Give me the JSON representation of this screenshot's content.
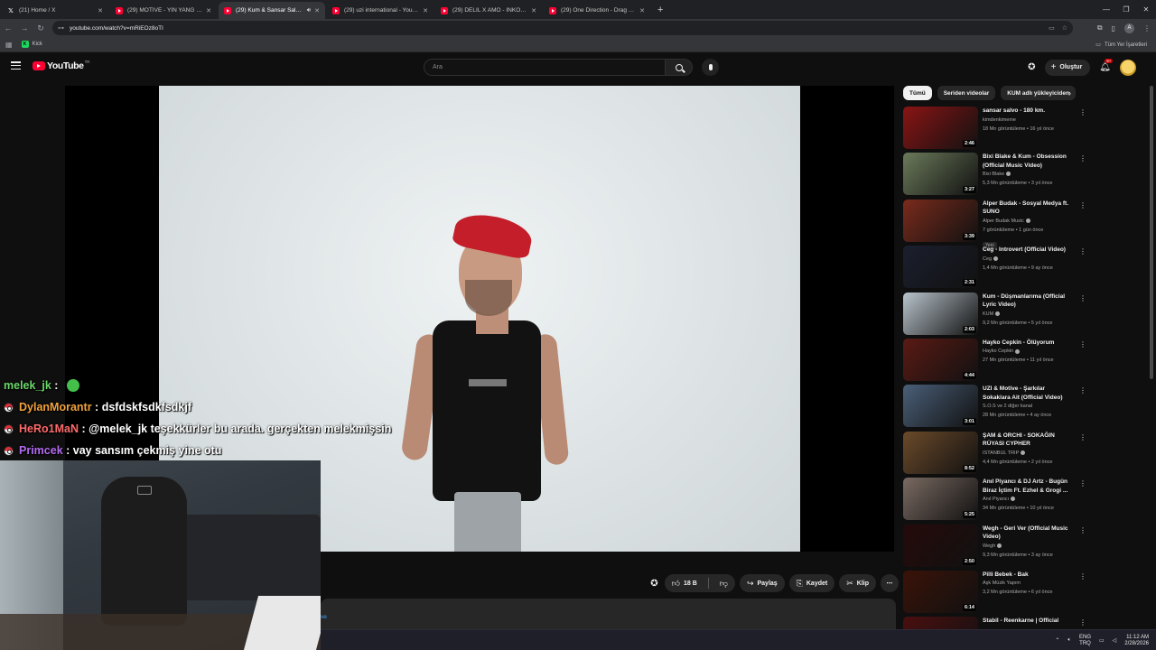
{
  "browser": {
    "tabs": [
      {
        "label": "(21) Home / X",
        "favicon": "x-icon",
        "active": false
      },
      {
        "label": "(29) MOTIVE - YIN YANG (Offici...",
        "favicon": "youtube-icon",
        "active": false
      },
      {
        "label": "(29) Kum & Sansar Salvo - S...",
        "favicon": "youtube-icon",
        "active": true,
        "audio": true
      },
      {
        "label": "(29) uzi international - YouTube",
        "favicon": "youtube-icon",
        "active": false
      },
      {
        "label": "(29) DELIL X AMO - INKOGNITO",
        "favicon": "youtube-icon",
        "active": false
      },
      {
        "label": "(29) One Direction - Drag Me D...",
        "favicon": "youtube-icon",
        "active": false
      }
    ],
    "url": "youtube.com/watch?v=mRiEOz8oTI",
    "bookmarks": [
      {
        "label": "Kick"
      }
    ],
    "all_bookmarks_label": "Tüm Yer İşaretleri"
  },
  "youtube": {
    "logo_text": "YouTube",
    "logo_country": "TR",
    "search_placeholder": "Ara",
    "create_label": "Oluştur",
    "notification_count": "9+"
  },
  "video": {
    "likes": "18 B",
    "share_label": "Paylaş",
    "save_label": "Kaydet",
    "clip_label": "Klip",
    "description_link": "ve"
  },
  "sidebar": {
    "chips": [
      {
        "label": "Tümü",
        "active": true
      },
      {
        "label": "Seriden videolar",
        "active": false
      },
      {
        "label": "KUM adlı yükleyiciden",
        "active": false
      }
    ],
    "recommendations": [
      {
        "title": "sansar salvo - 180 km.",
        "channel": "kimdenkimeme",
        "verified": false,
        "stats": "18 Mn görüntüleme • 16 yıl önce",
        "duration": "2:46",
        "thumb": "#8a1414",
        "badge": ""
      },
      {
        "title": "Bixi Blake & Kum - Obsession (Official Music Video)",
        "channel": "Bixi Blake",
        "verified": true,
        "stats": "5,3 Mn görüntüleme • 3 yıl önce",
        "duration": "3:27",
        "thumb": "#6b7a5a",
        "badge": ""
      },
      {
        "title": "Alper Budak - Sosyal Medya ft. SUNO",
        "channel": "Alper Budak Music",
        "verified": true,
        "stats": "7 görüntüleme • 1 gün önce",
        "duration": "3:39",
        "thumb": "#7a2b1c",
        "badge": "Yeni"
      },
      {
        "title": "Ceg - Introvert (Official Video)",
        "channel": "Ceg",
        "verified": true,
        "stats": "1,4 Mn görüntüleme • 9 ay önce",
        "duration": "2:31",
        "thumb": "#1b1f2e",
        "badge": ""
      },
      {
        "title": "Kum - Düşmanlarıma (Official Lyric Video)",
        "channel": "KUM",
        "verified": true,
        "stats": "9,2 Mn görüntüleme • 5 yıl önce",
        "duration": "2:03",
        "thumb": "#b9c4cc",
        "badge": ""
      },
      {
        "title": "Hayko Cepkin - Ölüyorum",
        "channel": "Hayko Cepkin",
        "verified": true,
        "stats": "27 Mn görüntüleme • 11 yıl önce",
        "duration": "4:44",
        "thumb": "#5a1a14",
        "badge": ""
      },
      {
        "title": "UZI & Motive - Şarkılar Sokaklara Ait (Official Video)",
        "channel": "S.O.S ve 2 diğer kanal",
        "verified": false,
        "stats": "28 Mn görüntüleme • 4 ay önce",
        "duration": "3:01",
        "thumb": "#4a5f78",
        "badge": ""
      },
      {
        "title": "ŞAM & ORCHI - SOKAĞIN RÜYASI CYPHER",
        "channel": "ISTANBUL TRIP",
        "verified": true,
        "stats": "4,4 Mn görüntüleme • 2 yıl önce",
        "duration": "8:52",
        "thumb": "#6b4a2a",
        "badge": ""
      },
      {
        "title": "Anıl Piyancı & DJ Artz - Bugün Biraz İçtim Ft. Ezhel & Grogi ...",
        "channel": "Anıl Piyancı",
        "verified": true,
        "stats": "34 Mn görüntüleme • 10 yıl önce",
        "duration": "5:25",
        "thumb": "#7a6a62",
        "badge": ""
      },
      {
        "title": "Wegh - Geri Ver (Official Music Video)",
        "channel": "Wegh",
        "verified": true,
        "stats": "9,3 Mn görüntüleme • 3 ay önce",
        "duration": "2:50",
        "thumb": "#260a0a",
        "badge": ""
      },
      {
        "title": "Pilli Bebek - Bak",
        "channel": "Aşk Müzik Yapım",
        "verified": false,
        "stats": "3,2 Mn görüntüleme • 6 yıl önce",
        "duration": "6:14",
        "thumb": "#3a1208",
        "badge": ""
      },
      {
        "title": "Stabil - Reenkarne | Official",
        "channel": "",
        "verified": false,
        "stats": "",
        "duration": "",
        "thumb": "#4a0f0f",
        "badge": ""
      }
    ]
  },
  "chat": {
    "messages": [
      {
        "user": "melek_jk",
        "text": "",
        "badge": false,
        "emote": true,
        "color_class": "u1"
      },
      {
        "user": "DylanMorantr",
        "text": "dsfdskfsdkfsdkjf",
        "badge": true,
        "emote": false,
        "color_class": "u2"
      },
      {
        "user": "HeRo1MaN",
        "text": "@melek_jk teşekkürler bu arada. gerçekten melekmişsin",
        "badge": true,
        "emote": false,
        "color_class": "u3"
      },
      {
        "user": "Primcek",
        "text": "vay sansım çekmiş yine otu",
        "badge": true,
        "emote": false,
        "color_class": "u4"
      }
    ]
  },
  "taskbar": {
    "lang_top": "ENG",
    "lang_bottom": "TRQ",
    "time": "11:12 AM",
    "date": "2/28/2026"
  }
}
